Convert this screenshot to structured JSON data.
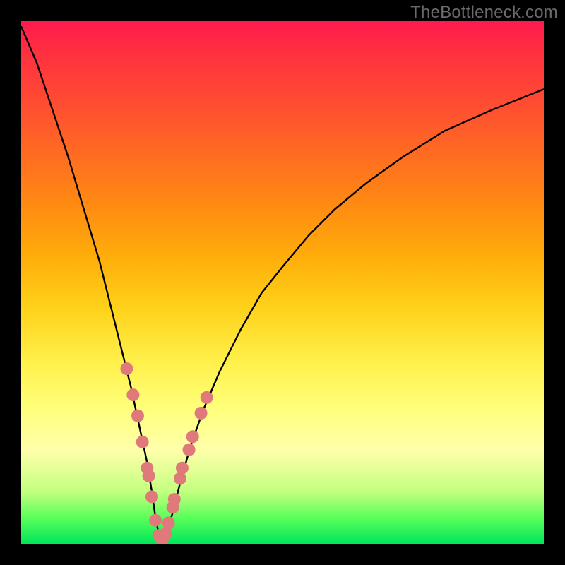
{
  "watermark": {
    "text": "TheBottleneck.com"
  },
  "chart_data": {
    "type": "line",
    "title": "",
    "xlabel": "",
    "ylabel": "",
    "xlim": [
      0,
      100
    ],
    "ylim": [
      0,
      100
    ],
    "grid": false,
    "legend": false,
    "series": [
      {
        "name": "bottleneck-curve",
        "color": "#000000",
        "x": [
          0,
          3,
          6,
          9,
          12,
          15,
          17,
          19,
          21,
          22.5,
          24,
          25,
          25.7,
          26.3,
          27,
          27.8,
          29,
          30.5,
          32.5,
          35,
          38,
          42,
          46,
          50,
          55,
          60,
          66,
          73,
          81,
          90,
          100
        ],
        "y": [
          99,
          92,
          83,
          74,
          64,
          54,
          46,
          38,
          30,
          23,
          16,
          10,
          5,
          2,
          0.5,
          2,
          6,
          12,
          19,
          26,
          33,
          41,
          48,
          53,
          59,
          64,
          69,
          74,
          79,
          83,
          87
        ]
      }
    ],
    "markers": [
      {
        "name": "highlight-dots",
        "color": "#e07a7a",
        "radius_px": 9,
        "x": [
          20.2,
          21.4,
          22.3,
          23.2,
          24.1,
          24.4,
          25.0,
          25.7,
          26.3,
          27.0,
          27.7,
          28.2,
          29.0,
          29.3,
          30.4,
          30.8,
          32.1,
          32.8,
          34.4,
          35.5
        ],
        "y": [
          33.5,
          28.5,
          24.5,
          19.5,
          14.5,
          13.0,
          9.0,
          4.5,
          1.6,
          0.7,
          2.0,
          4.0,
          7.0,
          8.5,
          12.5,
          14.5,
          18.0,
          20.5,
          25.0,
          28.0
        ]
      }
    ]
  }
}
